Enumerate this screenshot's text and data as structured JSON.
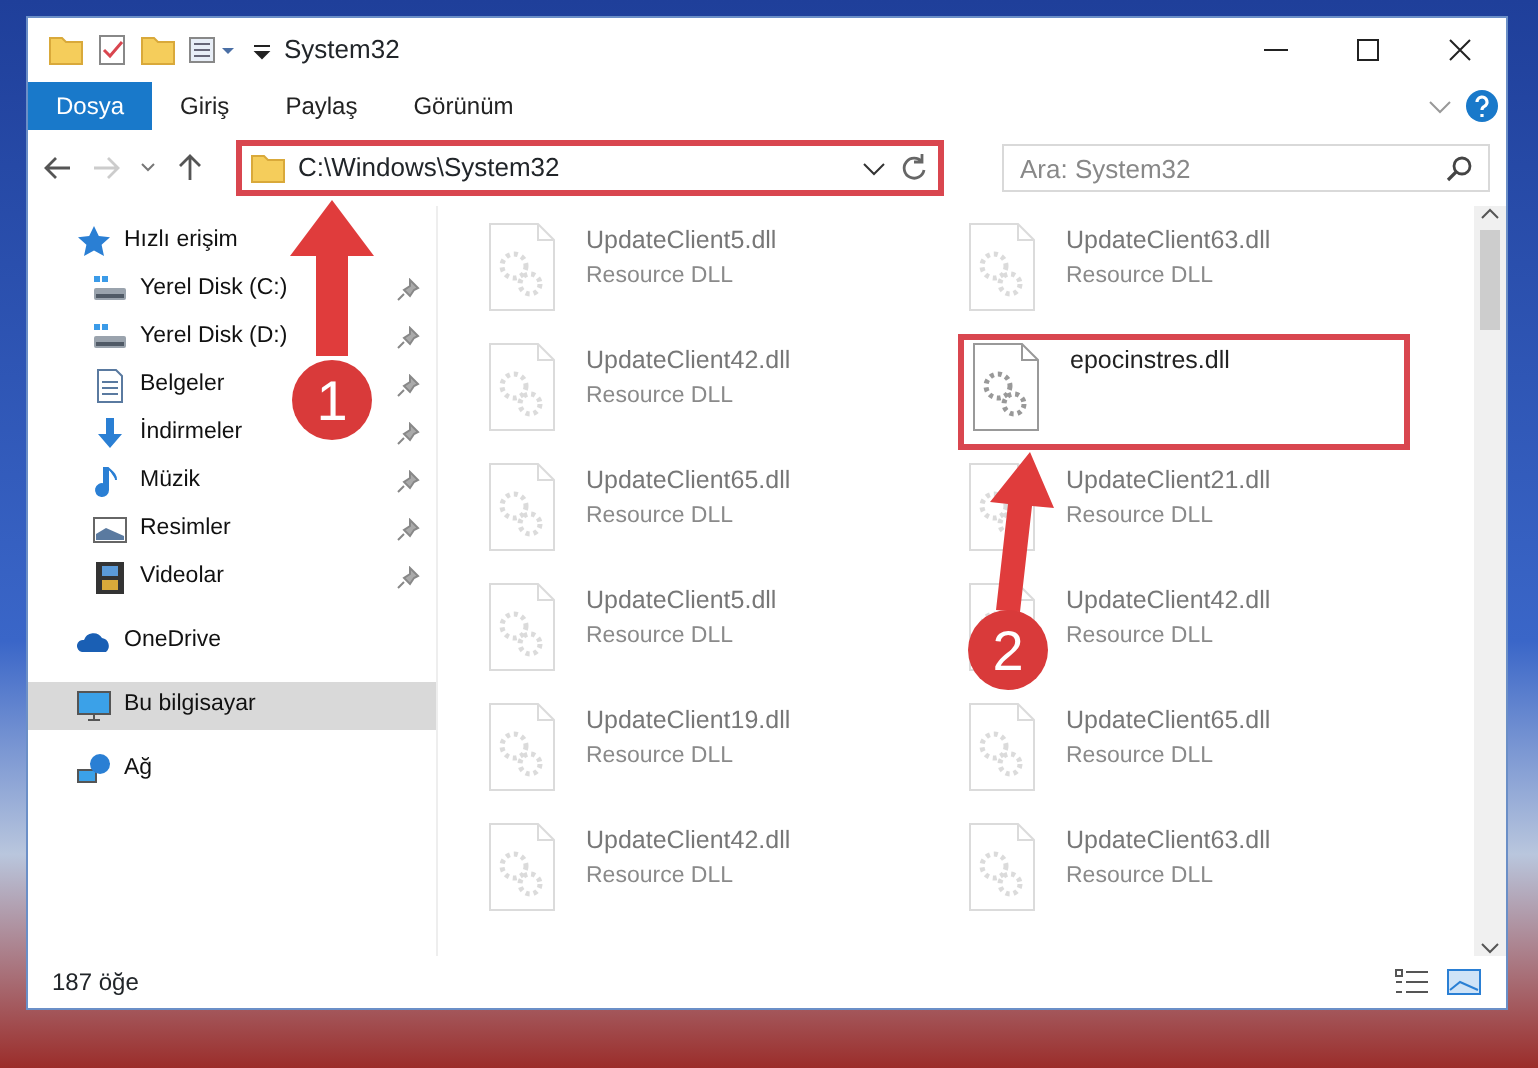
{
  "window": {
    "title": "System32"
  },
  "ribbon_tabs": [
    {
      "label": "Dosya",
      "selected": true
    },
    {
      "label": "Giriş",
      "selected": false
    },
    {
      "label": "Paylaş",
      "selected": false
    },
    {
      "label": "Görünüm",
      "selected": false
    }
  ],
  "address_bar": {
    "path": "C:\\Windows\\System32",
    "highlighted": true
  },
  "search": {
    "placeholder": "Ara: System32"
  },
  "sidebar": {
    "items": [
      {
        "label": "Hızlı erişim",
        "selected": false,
        "children": [
          {
            "label": "Yerel Disk (C:)",
            "pinned": true,
            "selected": false
          },
          {
            "label": "Yerel Disk (D:)",
            "pinned": true,
            "selected": false
          },
          {
            "label": "Belgeler",
            "pinned": true,
            "selected": false
          },
          {
            "label": "İndirmeler",
            "pinned": true,
            "selected": false
          },
          {
            "label": "Müzik",
            "pinned": true,
            "selected": false
          },
          {
            "label": "Resimler",
            "pinned": true,
            "selected": false
          },
          {
            "label": "Videolar",
            "pinned": true,
            "selected": false
          }
        ]
      },
      {
        "label": "OneDrive",
        "selected": false
      },
      {
        "label": "Bu bilgisayar",
        "selected": true
      },
      {
        "label": "Ağ",
        "selected": false
      }
    ]
  },
  "files": [
    {
      "name": "UpdateClient5.dll",
      "type": "Resource DLL",
      "dimmed": true,
      "highlighted": false
    },
    {
      "name": "UpdateClient63.dll",
      "type": "Resource DLL",
      "dimmed": true,
      "highlighted": false
    },
    {
      "name": "UpdateClient42.dll",
      "type": "Resource DLL",
      "dimmed": true,
      "highlighted": false
    },
    {
      "name": "epocinstres.dll",
      "dimmed": false,
      "highlighted": true
    },
    {
      "name": "UpdateClient65.dll",
      "type": "Resource DLL",
      "dimmed": true,
      "highlighted": false
    },
    {
      "name": "UpdateClient21.dll",
      "type": "Resource DLL",
      "dimmed": true,
      "highlighted": false
    },
    {
      "name": "UpdateClient5.dll",
      "type": "Resource DLL",
      "dimmed": true,
      "highlighted": false
    },
    {
      "name": "UpdateClient42.dll",
      "type": "Resource DLL",
      "dimmed": true,
      "highlighted": false
    },
    {
      "name": "UpdateClient19.dll",
      "type": "Resource DLL",
      "dimmed": true,
      "highlighted": false
    },
    {
      "name": "UpdateClient65.dll",
      "type": "Resource DLL",
      "dimmed": true,
      "highlighted": false
    },
    {
      "name": "UpdateClient42.dll",
      "type": "Resource DLL",
      "dimmed": true,
      "highlighted": false
    },
    {
      "name": "UpdateClient63.dll",
      "type": "Resource DLL",
      "dimmed": true,
      "highlighted": false
    }
  ],
  "status_bar": {
    "count": "187 öğe"
  },
  "annotations": [
    {
      "label": "1"
    },
    {
      "label": "2"
    }
  ]
}
